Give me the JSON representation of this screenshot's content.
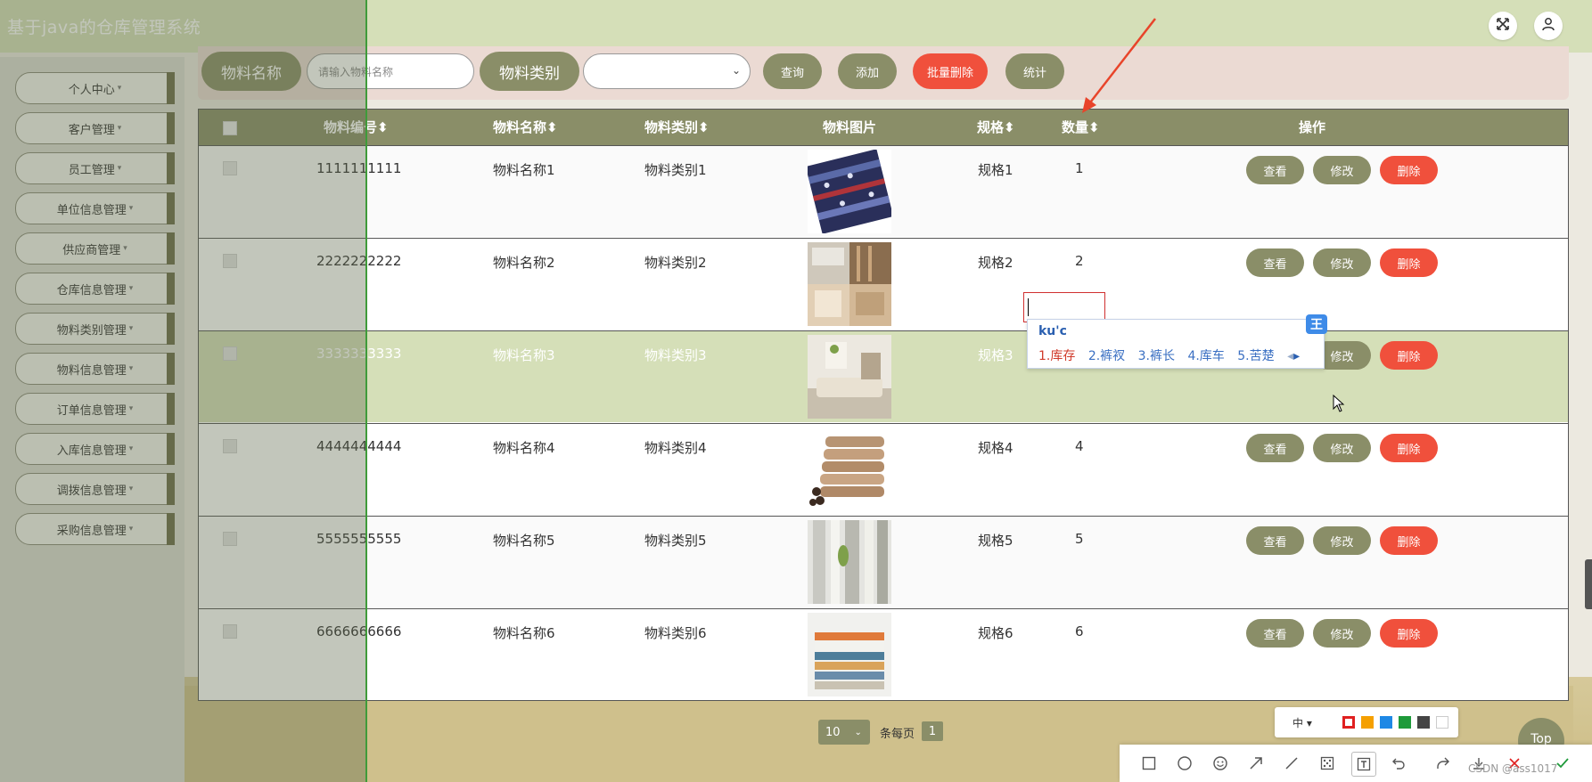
{
  "header": {
    "title": "基于java的仓库管理系统",
    "fullscreen_icon": "expand-icon",
    "user_icon": "user-icon"
  },
  "sidebar": {
    "items": [
      {
        "label": "个人中心"
      },
      {
        "label": "客户管理"
      },
      {
        "label": "员工管理"
      },
      {
        "label": "单位信息管理"
      },
      {
        "label": "供应商管理"
      },
      {
        "label": "仓库信息管理"
      },
      {
        "label": "物料类别管理"
      },
      {
        "label": "物料信息管理"
      },
      {
        "label": "订单信息管理"
      },
      {
        "label": "入库信息管理"
      },
      {
        "label": "调拨信息管理"
      },
      {
        "label": "采购信息管理"
      }
    ],
    "caret": "▾"
  },
  "search": {
    "name_label": "物料名称",
    "name_placeholder": "请输入物料名称",
    "category_label": "物料类别",
    "category_value": "",
    "query_button": "查询",
    "add_button": "添加",
    "batch_delete_button": "批量删除",
    "stats_button": "统计"
  },
  "table": {
    "headers": {
      "code": "物料编号",
      "name": "物料名称",
      "category": "物料类别",
      "image": "物料图片",
      "spec": "规格",
      "qty": "数量",
      "ops": "操作"
    },
    "sort_glyph": "⬍",
    "rows": [
      {
        "code": "1111111111",
        "name": "物料名称1",
        "category": "物料类别1",
        "spec": "规格1",
        "qty": "1"
      },
      {
        "code": "2222222222",
        "name": "物料名称2",
        "category": "物料类别2",
        "spec": "规格2",
        "qty": "2"
      },
      {
        "code": "3333333333",
        "name": "物料名称3",
        "category": "物料类别3",
        "spec": "规格3",
        "qty": ""
      },
      {
        "code": "4444444444",
        "name": "物料名称4",
        "category": "物料类别4",
        "spec": "规格4",
        "qty": "4"
      },
      {
        "code": "5555555555",
        "name": "物料名称5",
        "category": "物料类别5",
        "spec": "规格5",
        "qty": "5"
      },
      {
        "code": "6666666666",
        "name": "物料名称6",
        "category": "物料类别6",
        "spec": "规格6",
        "qty": "6"
      }
    ],
    "view_label": "查看",
    "edit_label": "修改",
    "delete_label": "删除"
  },
  "ime": {
    "composition": "ku'c",
    "candidates": [
      "1.库存",
      "2.裤衩",
      "3.裤长",
      "4.库车",
      "5.苦楚"
    ],
    "logo": "王"
  },
  "pagination": {
    "page_size": "10",
    "per_page_label": "条每页",
    "current_page": "1"
  },
  "annot": {
    "size": "中",
    "colors": [
      "#e02020",
      "#f5a000",
      "#1e88e5",
      "#1e9a3a",
      "#444444",
      "#ffffff"
    ]
  },
  "top_button": "Top",
  "watermark": "CSDN @ass1017",
  "colors": {
    "accent": "#8a8e68",
    "danger": "#f0503c",
    "highlight_row": "#d5dfb8",
    "annotation_arrow": "#e8442a"
  }
}
